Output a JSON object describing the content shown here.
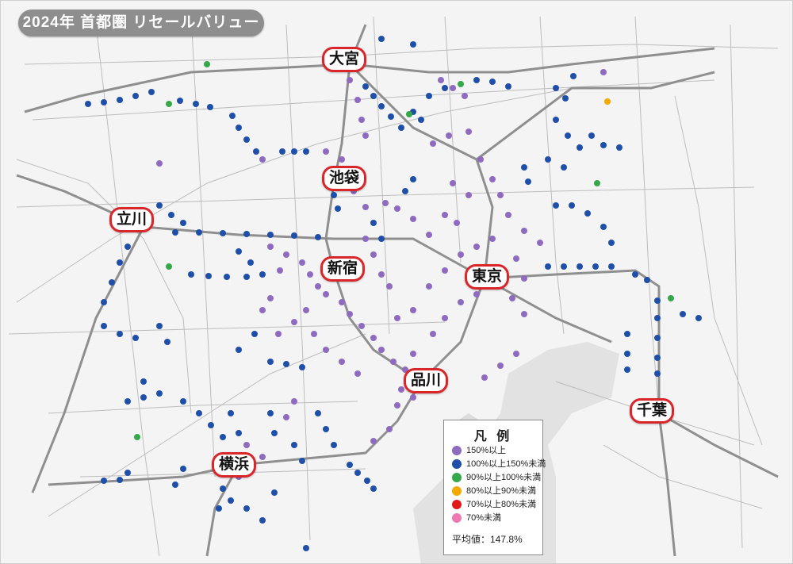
{
  "title": "2024年 首都圏 リセールバリュー",
  "stations": {
    "omiya": "大宮",
    "ikebukuro": "池袋",
    "tachikawa": "立川",
    "shinjuku": "新宿",
    "tokyo": "東京",
    "shinagawa": "品川",
    "chiba": "千葉",
    "yokohama": "横浜"
  },
  "legend": {
    "title": "凡 例",
    "items": [
      {
        "label": "150%以上",
        "color": "#8e6bbf"
      },
      {
        "label": "100%以上150%未満",
        "color": "#1f4fa8"
      },
      {
        "label": "90%以上100%未満",
        "color": "#35a849"
      },
      {
        "label": "80%以上90%未満",
        "color": "#f2a900"
      },
      {
        "label": "70%以上80%未満",
        "color": "#e01a1a"
      },
      {
        "label": "70%未満",
        "color": "#ef7ab1"
      }
    ],
    "average": "平均値：147.8%"
  }
}
